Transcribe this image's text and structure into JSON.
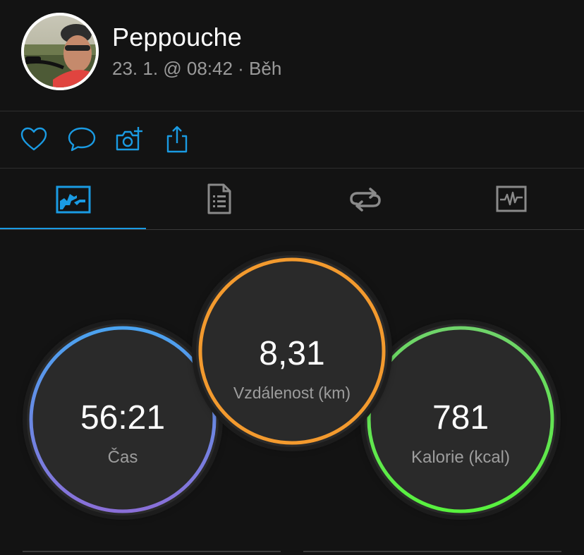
{
  "user": {
    "name": "Peppouche",
    "meta": "23. 1. @ 08:42 · Běh"
  },
  "actions": [
    {
      "name": "like-button",
      "icon": "heart-icon"
    },
    {
      "name": "comment-button",
      "icon": "comment-icon"
    },
    {
      "name": "add-photo-button",
      "icon": "camera-plus-icon"
    },
    {
      "name": "share-button",
      "icon": "share-icon"
    }
  ],
  "tabs": [
    {
      "name": "tab-overview",
      "icon": "overview-chart-icon",
      "active": true
    },
    {
      "name": "tab-details",
      "icon": "document-icon",
      "active": false
    },
    {
      "name": "tab-laps",
      "icon": "repeat-icon",
      "active": false
    },
    {
      "name": "tab-graphs",
      "icon": "heart-rate-chart-icon",
      "active": false
    }
  ],
  "stats": {
    "time": {
      "value": "56:21",
      "label": "Čas"
    },
    "distance": {
      "value": "8,31",
      "label": "Vzdálenost (km)"
    },
    "calories": {
      "value": "781",
      "label": "Kalorie (kcal)"
    }
  },
  "colors": {
    "background": "#131313",
    "accent": "#1a9be3",
    "time_ring_start": "#4aa3f0",
    "time_ring_end": "#8a6fd8",
    "distance_ring": "#f39a2e",
    "calories_ring_start": "#6fd36a",
    "calories_ring_end": "#58f23e"
  }
}
